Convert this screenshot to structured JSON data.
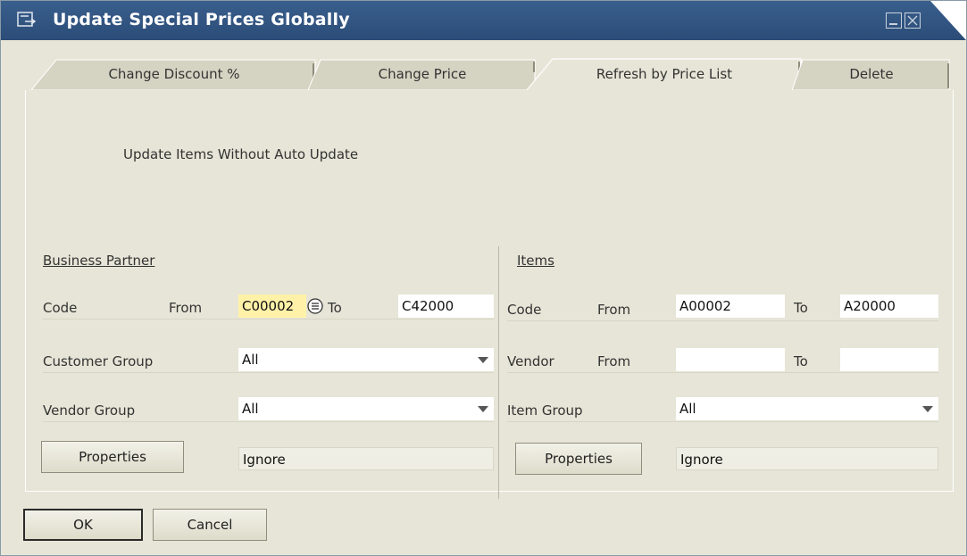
{
  "window": {
    "title": "Update Special Prices Globally"
  },
  "tabs": [
    {
      "label": "Change Discount %",
      "active": false
    },
    {
      "label": "Change Price",
      "active": false
    },
    {
      "label": "Refresh by Price List",
      "active": true
    },
    {
      "label": "Delete",
      "active": false
    }
  ],
  "panel": {
    "option_text": "Update Items Without Auto Update"
  },
  "business_partner": {
    "heading": "Business Partner",
    "code_label": "Code",
    "from_label": "From",
    "code_from": "C00002",
    "to_label": "To",
    "code_to": "C42000",
    "customer_group_label": "Customer Group",
    "customer_group_value": "All",
    "vendor_group_label": "Vendor Group",
    "vendor_group_value": "All",
    "properties_button": "Properties",
    "properties_value": "Ignore"
  },
  "items": {
    "heading": "Items",
    "code_label": "Code",
    "from_label": "From",
    "code_from": "A00002",
    "to_label": "To",
    "code_to": "A20000",
    "vendor_label": "Vendor",
    "vendor_from_label": "From",
    "vendor_from": "",
    "vendor_to_label": "To",
    "vendor_to": "",
    "item_group_label": "Item Group",
    "item_group_value": "All",
    "properties_button": "Properties",
    "properties_value": "Ignore"
  },
  "footer": {
    "ok_label": "OK",
    "cancel_label": "Cancel"
  },
  "colors": {
    "title_bar": "#2b4c77",
    "background": "#e6e5d7",
    "highlight_field": "#fff2a8"
  }
}
